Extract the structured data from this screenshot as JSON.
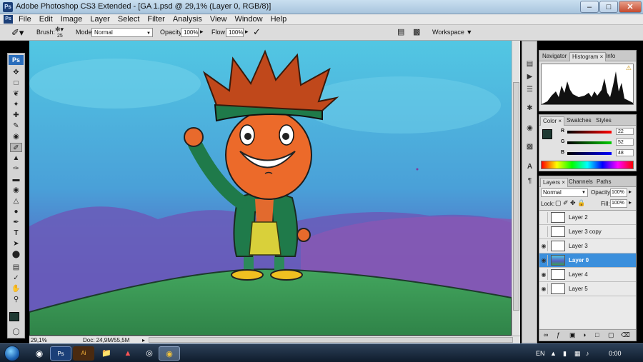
{
  "window": {
    "title": "Adobe Photoshop CS3 Extended - [GA 1.psd @ 29,1% (Layer 0, RGB/8)]",
    "logo": "Ps"
  },
  "menu": [
    "File",
    "Edit",
    "Image",
    "Layer",
    "Select",
    "Filter",
    "Analysis",
    "View",
    "Window",
    "Help"
  ],
  "options": {
    "brush_label": "Brush:",
    "brush_size": "25",
    "mode_label": "Mode:",
    "mode_value": "Normal",
    "opacity_label": "Opacity:",
    "opacity_value": "100%",
    "flow_label": "Flow:",
    "flow_value": "100%",
    "workspace_label": "Workspace"
  },
  "toolbox": {
    "logo": "Ps",
    "foreground_color": "#1f3a33",
    "background_color": "#ffffff"
  },
  "status": {
    "zoom": "29,1%",
    "doc_info": "Doc: 24,9M/55,5M"
  },
  "panels": {
    "navigator_tabs": [
      "Navigator",
      "Histogram",
      "Info"
    ],
    "color_tabs": [
      "Color",
      "Swatches",
      "Styles"
    ],
    "color": {
      "r_label": "R",
      "r_value": "22",
      "g_label": "G",
      "g_value": "52",
      "b_label": "B",
      "b_value": "48"
    },
    "layers_tabs": [
      "Layers",
      "Channels",
      "Paths"
    ],
    "layers": {
      "blend_mode": "Normal",
      "opacity_label": "Opacity:",
      "opacity_value": "100%",
      "lock_label": "Lock:",
      "fill_label": "Fill:",
      "fill_value": "100%",
      "items": [
        {
          "name": "Layer 2",
          "visible": false,
          "selected": false
        },
        {
          "name": "Layer 3 copy",
          "visible": false,
          "selected": false
        },
        {
          "name": "Layer 3",
          "visible": true,
          "selected": false
        },
        {
          "name": "Layer 0",
          "visible": true,
          "selected": true
        },
        {
          "name": "Layer 4",
          "visible": true,
          "selected": false
        },
        {
          "name": "Layer 5",
          "visible": true,
          "selected": false
        }
      ]
    }
  },
  "taskbar": {
    "language": "EN",
    "clock": "0:00",
    "apps": [
      "Ps",
      "Ai"
    ]
  },
  "colors": {
    "accent_selected": "#3b8fdc",
    "sky": "#55c3e3",
    "hill": "#3a9c58"
  }
}
